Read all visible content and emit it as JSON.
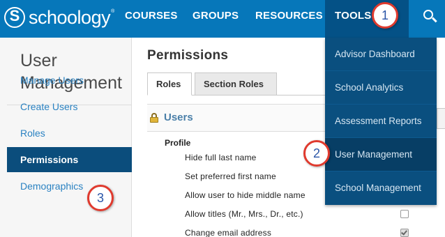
{
  "brand": {
    "logo_letter": "S",
    "name": "schoology",
    "tm": "®"
  },
  "nav": {
    "courses": "COURSES",
    "groups": "GROUPS",
    "resources": "RESOURCES",
    "tools": "TOOLS"
  },
  "tools_menu": {
    "items": [
      {
        "label": "Advisor Dashboard"
      },
      {
        "label": "School Analytics"
      },
      {
        "label": "Assessment Reports"
      },
      {
        "label": "User Management"
      },
      {
        "label": "School Management"
      }
    ]
  },
  "sidebar": {
    "title": "User Management",
    "items": [
      {
        "label": "Manage Users"
      },
      {
        "label": "Create Users"
      },
      {
        "label": "Roles"
      },
      {
        "label": "Permissions"
      },
      {
        "label": "Demographics"
      }
    ]
  },
  "main": {
    "title": "Permissions",
    "tabs": [
      {
        "label": "Roles"
      },
      {
        "label": "Section Roles"
      }
    ],
    "section_title": "Users",
    "group_heading": "Profile",
    "permissions": [
      {
        "label": "Hide full last name"
      },
      {
        "label": "Set preferred first name"
      },
      {
        "label": "Allow user to hide middle name"
      },
      {
        "label": "Allow titles (Mr., Mrs., Dr., etc.)",
        "checked": false
      },
      {
        "label": "Change email address",
        "checked": true
      }
    ]
  },
  "annotations": {
    "step1": "1",
    "step2": "2",
    "step3": "3"
  },
  "colors": {
    "nav_bg": "#0677ba",
    "tools_active_bg": "#045186",
    "dropdown_bg": "#0a4f7f",
    "sidebar_active_bg": "#0b4d7c",
    "link": "#2a82c2",
    "marker_border": "#e03a2e"
  }
}
